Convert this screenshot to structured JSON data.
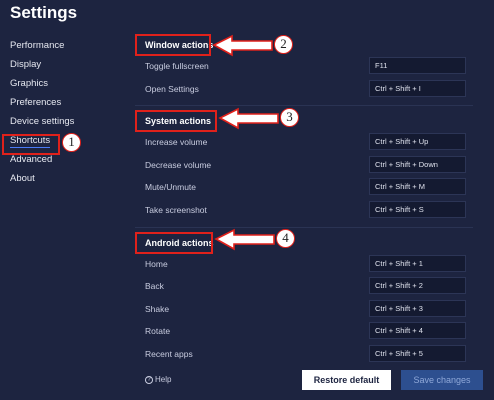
{
  "title": "Settings",
  "sidebar": {
    "items": [
      {
        "label": "Performance"
      },
      {
        "label": "Display"
      },
      {
        "label": "Graphics"
      },
      {
        "label": "Preferences"
      },
      {
        "label": "Device settings"
      },
      {
        "label": "Shortcuts"
      },
      {
        "label": "Advanced"
      },
      {
        "label": "About"
      }
    ],
    "active_index": 5
  },
  "sections": [
    {
      "title": "Window actions",
      "callout": "2",
      "rows": [
        {
          "label": "Toggle fullscreen",
          "key": "F11"
        },
        {
          "label": "Open Settings",
          "key": "Ctrl + Shift + I"
        }
      ]
    },
    {
      "title": "System actions",
      "callout": "3",
      "rows": [
        {
          "label": "Increase volume",
          "key": "Ctrl + Shift + Up"
        },
        {
          "label": "Decrease volume",
          "key": "Ctrl + Shift + Down"
        },
        {
          "label": "Mute/Unmute",
          "key": "Ctrl + Shift + M"
        },
        {
          "label": "Take screenshot",
          "key": "Ctrl + Shift + S"
        }
      ]
    },
    {
      "title": "Android actions",
      "callout": "4",
      "rows": [
        {
          "label": "Home",
          "key": "Ctrl + Shift + 1"
        },
        {
          "label": "Back",
          "key": "Ctrl + Shift + 2"
        },
        {
          "label": "Shake",
          "key": "Ctrl + Shift + 3"
        },
        {
          "label": "Rotate",
          "key": "Ctrl + Shift + 4"
        },
        {
          "label": "Recent apps",
          "key": "Ctrl + Shift + 5"
        }
      ]
    }
  ],
  "sidebar_callout": "1",
  "footer": {
    "help_label": "Help",
    "help_icon_glyph": "?",
    "restore_label": "Restore default",
    "save_label": "Save changes"
  },
  "colors": {
    "background": "#1d2440",
    "annotation_red": "#e0211b",
    "accent": "#4a7bf7"
  }
}
